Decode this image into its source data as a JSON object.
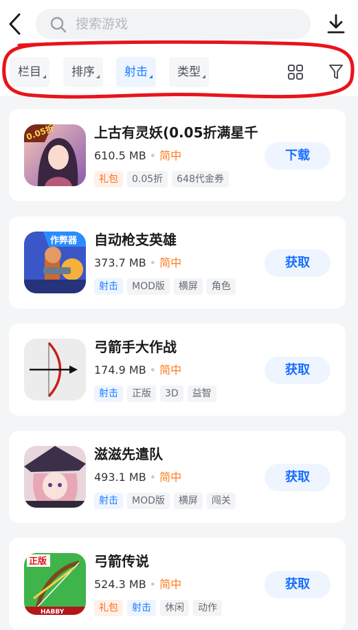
{
  "search": {
    "placeholder": "搜索游戏"
  },
  "filters": [
    {
      "label": "栏目",
      "active": false
    },
    {
      "label": "排序",
      "active": false
    },
    {
      "label": "射击",
      "active": true
    },
    {
      "label": "类型",
      "active": false
    }
  ],
  "colors": {
    "accent": "#1a7cff",
    "language": "#ff7a1a",
    "gift": "#ff6a1a",
    "annotation": "#e8141b"
  },
  "games": [
    {
      "title": "上古有灵妖(0.05折满星千",
      "size": "610.5 MB",
      "language": "简中",
      "action": "下载",
      "icon_badge": "0.05折",
      "icon": "fantasy-girl-icon",
      "tags": [
        {
          "label": "礼包",
          "type": "gift"
        },
        {
          "label": "0.05折",
          "type": "plain"
        },
        {
          "label": "648代金券",
          "type": "plain"
        }
      ]
    },
    {
      "title": "自动枪支英雄",
      "size": "373.7 MB",
      "language": "简中",
      "action": "获取",
      "icon_badge": "作弊器",
      "icon": "gunner-hero-icon",
      "tags": [
        {
          "label": "射击",
          "type": "shoot"
        },
        {
          "label": "MOD版",
          "type": "plain"
        },
        {
          "label": "横屏",
          "type": "plain"
        },
        {
          "label": "角色",
          "type": "plain"
        }
      ]
    },
    {
      "title": "弓箭手大作战",
      "size": "174.9 MB",
      "language": "简中",
      "action": "获取",
      "icon_badge": "",
      "icon": "bow-arrow-icon",
      "tags": [
        {
          "label": "射击",
          "type": "shoot"
        },
        {
          "label": "正版",
          "type": "plain"
        },
        {
          "label": "3D",
          "type": "plain"
        },
        {
          "label": "益智",
          "type": "plain"
        }
      ]
    },
    {
      "title": "滋滋先遣队",
      "size": "493.1 MB",
      "language": "简中",
      "action": "获取",
      "icon_badge": "",
      "icon": "witch-girl-icon",
      "tags": [
        {
          "label": "射击",
          "type": "shoot"
        },
        {
          "label": "MOD版",
          "type": "plain"
        },
        {
          "label": "横屏",
          "type": "plain"
        },
        {
          "label": "闯关",
          "type": "plain"
        }
      ]
    },
    {
      "title": "弓箭传说",
      "size": "524.3 MB",
      "language": "简中",
      "action": "获取",
      "icon_badge": "正版",
      "icon_caption": "HABBY",
      "icon": "green-bow-icon",
      "tags": [
        {
          "label": "礼包",
          "type": "gift"
        },
        {
          "label": "射击",
          "type": "shoot"
        },
        {
          "label": "休闲",
          "type": "plain"
        },
        {
          "label": "动作",
          "type": "plain"
        }
      ]
    }
  ]
}
